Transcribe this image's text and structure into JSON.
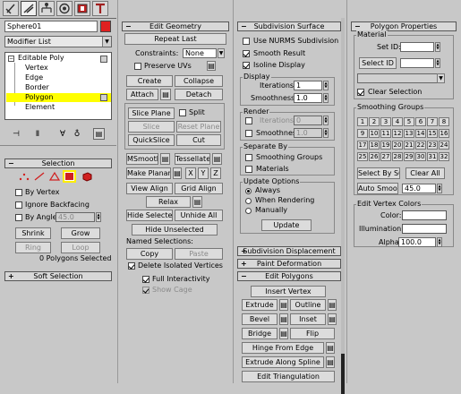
{
  "tabs": {
    "icons": [
      "create-icon",
      "modify-icon",
      "hierarchy-icon",
      "motion-icon",
      "display-icon",
      "utilities-icon"
    ]
  },
  "object": {
    "name": "Sphere01",
    "color": "#e02020"
  },
  "modifier_list": {
    "label": "Modifier List"
  },
  "stack": {
    "items": [
      "Editable Poly",
      "Vertex",
      "Edge",
      "Border",
      "Polygon",
      "Element"
    ],
    "selected": "Polygon"
  },
  "stack_toolbar": {
    "icons": [
      "pin-stack-icon",
      "show-end-result-icon",
      "make-unique-icon",
      "remove-modifier-icon",
      "configure-modifier-sets-icon"
    ]
  },
  "selection": {
    "title": "Selection",
    "by_vertex": "By Vertex",
    "ignore_backfacing": "Ignore Backfacing",
    "by_angle": "By Angle",
    "by_angle_value": "45.0",
    "shrink": "Shrink",
    "grow": "Grow",
    "ring": "Ring",
    "loop": "Loop",
    "status": "0 Polygons Selected"
  },
  "soft_selection": {
    "title": "Soft Selection"
  },
  "edit_geometry": {
    "title": "Edit Geometry",
    "repeat_last": "Repeat Last",
    "constraints_label": "Constraints:",
    "constraints_value": "None",
    "preserve_uvs": "Preserve UVs",
    "create": "Create",
    "collapse": "Collapse",
    "attach": "Attach",
    "detach": "Detach",
    "slice_plane": "Slice Plane",
    "split": "Split",
    "slice": "Slice",
    "reset_plane": "Reset Plane",
    "quickslice": "QuickSlice",
    "cut": "Cut",
    "msmooth": "MSmooth",
    "tessellate": "Tessellate",
    "make_planar": "Make Planar",
    "x": "X",
    "y": "Y",
    "z": "Z",
    "view_align": "View Align",
    "grid_align": "Grid Align",
    "relax": "Relax",
    "hide_selected": "Hide Selected",
    "unhide_all": "Unhide All",
    "hide_unselected": "Hide Unselected",
    "named_selections": "Named Selections:",
    "copy": "Copy",
    "paste": "Paste",
    "delete_isolated": "Delete Isolated Vertices",
    "full_interactivity": "Full Interactivity",
    "show_cage": "Show Cage"
  },
  "subdivision_surface": {
    "title": "Subdivision Surface",
    "use_nurms": "Use NURMS Subdivision",
    "smooth_result": "Smooth Result",
    "isoline_display": "Isoline Display",
    "display_label": "Display",
    "iterations_label": "Iterations:",
    "display_iterations": "1",
    "smoothness_label": "Smoothness:",
    "display_smoothness": "1.0",
    "render_label": "Render",
    "render_iterations": "0",
    "render_smoothness": "1.0",
    "separate_by": "Separate By",
    "smoothing_groups": "Smoothing Groups",
    "materials": "Materials",
    "update_options": "Update Options",
    "always": "Always",
    "when_rendering": "When Rendering",
    "manually": "Manually",
    "update": "Update"
  },
  "collapsed_rollouts": [
    "Subdivision Displacement",
    "Paint Deformation"
  ],
  "edit_polygons": {
    "title": "Edit Polygons",
    "insert_vertex": "Insert Vertex",
    "extrude": "Extrude",
    "outline": "Outline",
    "bevel": "Bevel",
    "inset": "Inset",
    "bridge": "Bridge",
    "flip": "Flip",
    "hinge": "Hinge From Edge",
    "extrude_spline": "Extrude Along Spline",
    "edit_triangulation": "Edit Triangulation"
  },
  "polygon_properties": {
    "title": "Polygon Properties",
    "material": "Material",
    "set_id": "Set ID:",
    "select_id": "Select ID",
    "clear_selection": "Clear Selection",
    "smoothing_groups": "Smoothing Groups",
    "sg_numbers": [
      "1",
      "2",
      "3",
      "4",
      "5",
      "6",
      "7",
      "8",
      "9",
      "10",
      "11",
      "12",
      "13",
      "14",
      "15",
      "16",
      "17",
      "18",
      "19",
      "20",
      "21",
      "22",
      "23",
      "24",
      "25",
      "26",
      "27",
      "28",
      "29",
      "30",
      "31",
      "32"
    ],
    "select_by_sg": "Select By SG",
    "clear_all": "Clear All",
    "auto_smooth": "Auto Smooth",
    "auto_smooth_value": "45.0",
    "edit_vertex_colors": "Edit Vertex Colors",
    "color": "Color:",
    "illumination": "Illumination:",
    "alpha": "Alpha:",
    "alpha_value": "100.0"
  }
}
